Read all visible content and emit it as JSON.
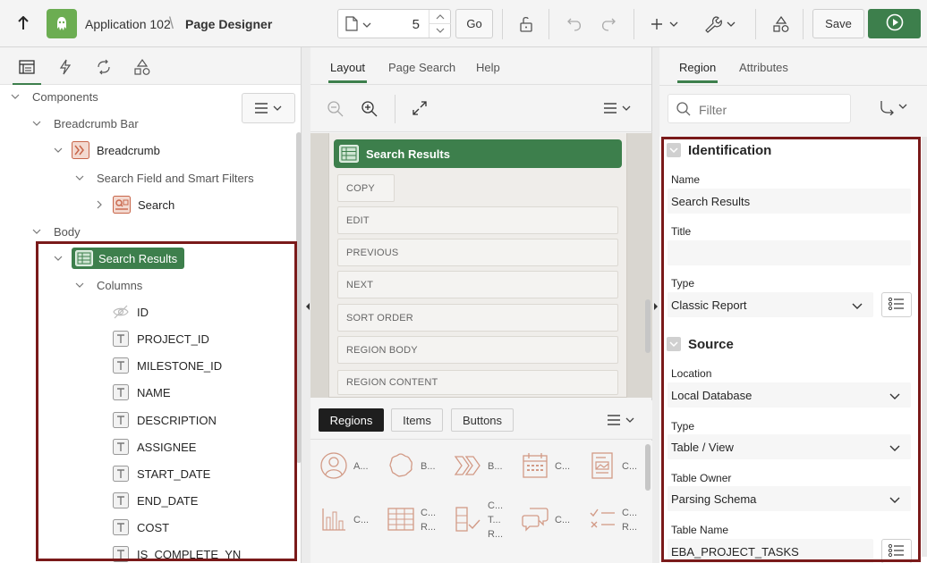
{
  "toolbar": {
    "app_name": "Application 102",
    "separator": "\\",
    "page_designer": "Page Designer",
    "page_number": "5",
    "go_label": "Go",
    "save_label": "Save",
    "icons": [
      "up-arrow-icon",
      "app-icon",
      "page-icon",
      "lock-icon",
      "undo-icon",
      "redo-icon",
      "plus-icon",
      "wrench-icon",
      "shapes-icon",
      "run-icon"
    ]
  },
  "left": {
    "tabs": [
      "rendering-tab",
      "dynamic-actions-tab",
      "processing-tab",
      "shared-components-tab"
    ],
    "tree": [
      {
        "label": "Components",
        "type": "group"
      },
      {
        "label": "Breadcrumb Bar",
        "type": "group"
      },
      {
        "label": "Breadcrumb",
        "type": "breadcrumb"
      },
      {
        "label": "Search Field and Smart Filters",
        "type": "group"
      },
      {
        "label": "Search",
        "type": "search"
      },
      {
        "label": "Body",
        "type": "group"
      },
      {
        "label": "Search Results",
        "type": "report"
      },
      {
        "label": "Columns",
        "type": "group"
      },
      {
        "label": "ID",
        "type": "hidden"
      },
      {
        "label": "PROJECT_ID",
        "type": "text"
      },
      {
        "label": "MILESTONE_ID",
        "type": "text"
      },
      {
        "label": "NAME",
        "type": "text"
      },
      {
        "label": "DESCRIPTION",
        "type": "text"
      },
      {
        "label": "ASSIGNEE",
        "type": "text"
      },
      {
        "label": "START_DATE",
        "type": "text"
      },
      {
        "label": "END_DATE",
        "type": "text"
      },
      {
        "label": "COST",
        "type": "text"
      },
      {
        "label": "IS_COMPLETE_YN",
        "type": "text"
      }
    ]
  },
  "center": {
    "tabs": [
      "Layout",
      "Page Search",
      "Help"
    ],
    "region_title": "Search Results",
    "slots": [
      "COPY",
      "EDIT",
      "PREVIOUS",
      "NEXT",
      "SORT ORDER",
      "REGION BODY",
      "REGION CONTENT"
    ],
    "gallery_tabs": [
      "Regions",
      "Items",
      "Buttons"
    ],
    "gallery_items": [
      {
        "icon": "avatar-icon",
        "lines": [
          "A..."
        ]
      },
      {
        "icon": "badge-icon",
        "lines": [
          "B..."
        ]
      },
      {
        "icon": "breadcrumb-icon",
        "lines": [
          "B..."
        ]
      },
      {
        "icon": "calendar-icon",
        "lines": [
          "C..."
        ]
      },
      {
        "icon": "card-icon",
        "lines": [
          "C..."
        ]
      },
      {
        "icon": "bar-chart-icon",
        "lines": [
          "C..."
        ]
      },
      {
        "icon": "grid-icon",
        "lines": [
          "C...",
          "R..."
        ]
      },
      {
        "icon": "checklist-icon",
        "lines": [
          "C...",
          "T...",
          "R..."
        ]
      },
      {
        "icon": "comments-icon",
        "lines": [
          "C..."
        ]
      },
      {
        "icon": "compare-icon",
        "lines": [
          "C...",
          "R..."
        ]
      }
    ]
  },
  "right": {
    "tabs": [
      "Region",
      "Attributes"
    ],
    "filter_placeholder": "Filter",
    "identification": {
      "heading": "Identification",
      "name_label": "Name",
      "name_value": "Search Results",
      "title_label": "Title",
      "title_value": "",
      "type_label": "Type",
      "type_value": "Classic Report"
    },
    "source": {
      "heading": "Source",
      "location_label": "Location",
      "location_value": "Local Database",
      "type_label": "Type",
      "type_value": "Table / View",
      "owner_label": "Table Owner",
      "owner_value": "Parsing Schema",
      "table_label": "Table Name",
      "table_value": "EBA_PROJECT_TASKS"
    }
  },
  "colors": {
    "accent_green": "#3d7f4c",
    "app_green": "#6cad52",
    "highlight_border": "#7a1a1a",
    "component_orange": "#c8664a"
  }
}
